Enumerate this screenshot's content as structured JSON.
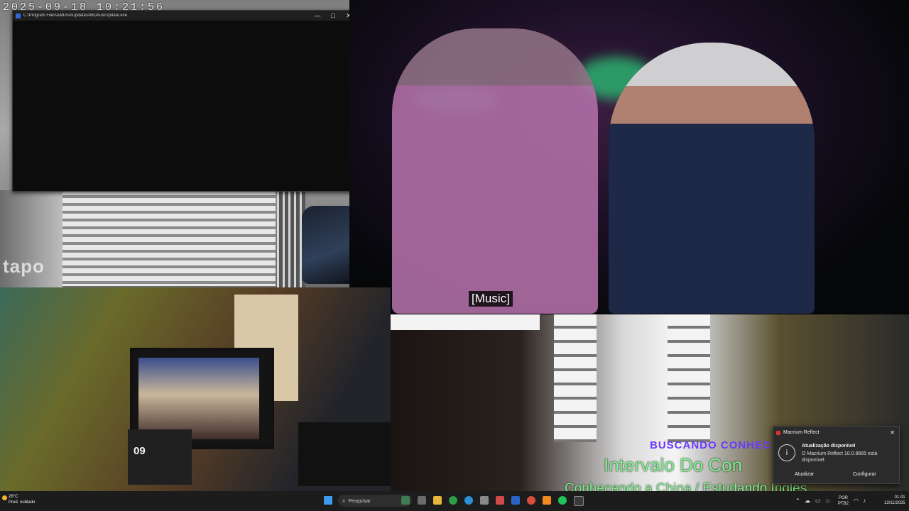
{
  "camera_top": {
    "timestamp": "2025-09-18  10:21:56",
    "watermark": "tapo"
  },
  "console": {
    "title": "C:\\Program Files\\AMD\\Ai\\Update\\AMDAutoUpdate.exe",
    "min": "—",
    "max": "□",
    "close": "✕"
  },
  "video": {
    "subtitle": "[Music]"
  },
  "room_camera": {
    "calendar_day": "09"
  },
  "studio_overlay": {
    "line1": "BUSCANDO CONHEC",
    "line2": "Intervalo Do Con",
    "line3": "Conhecendo a China / Estudando Ingles"
  },
  "notification": {
    "app": "Macrium Reflect",
    "title": "Atualização disponível",
    "message": "O Macrium Reflect 10.0.8665 está disponível.",
    "btn_update": "Atualizar",
    "btn_configure": "Configurar",
    "close": "✕",
    "info_glyph": "i"
  },
  "taskbar": {
    "weather_temp": "28°C",
    "weather_desc": "Pred. nublado",
    "search_placeholder": "Pesquisar",
    "lang1": "POR",
    "lang2": "PTB2",
    "time": "01:41",
    "date": "12/11/2025",
    "icons": [
      "start-icon",
      "file-explorer-icon",
      "chrome-icon",
      "edge-icon",
      "store-icon",
      "mail-icon",
      "obs-icon",
      "settings-icon",
      "chrome-alt-icon",
      "vlc-icon",
      "spotify-icon",
      "capcut-icon"
    ],
    "tray_up_arrow": "⌃"
  }
}
